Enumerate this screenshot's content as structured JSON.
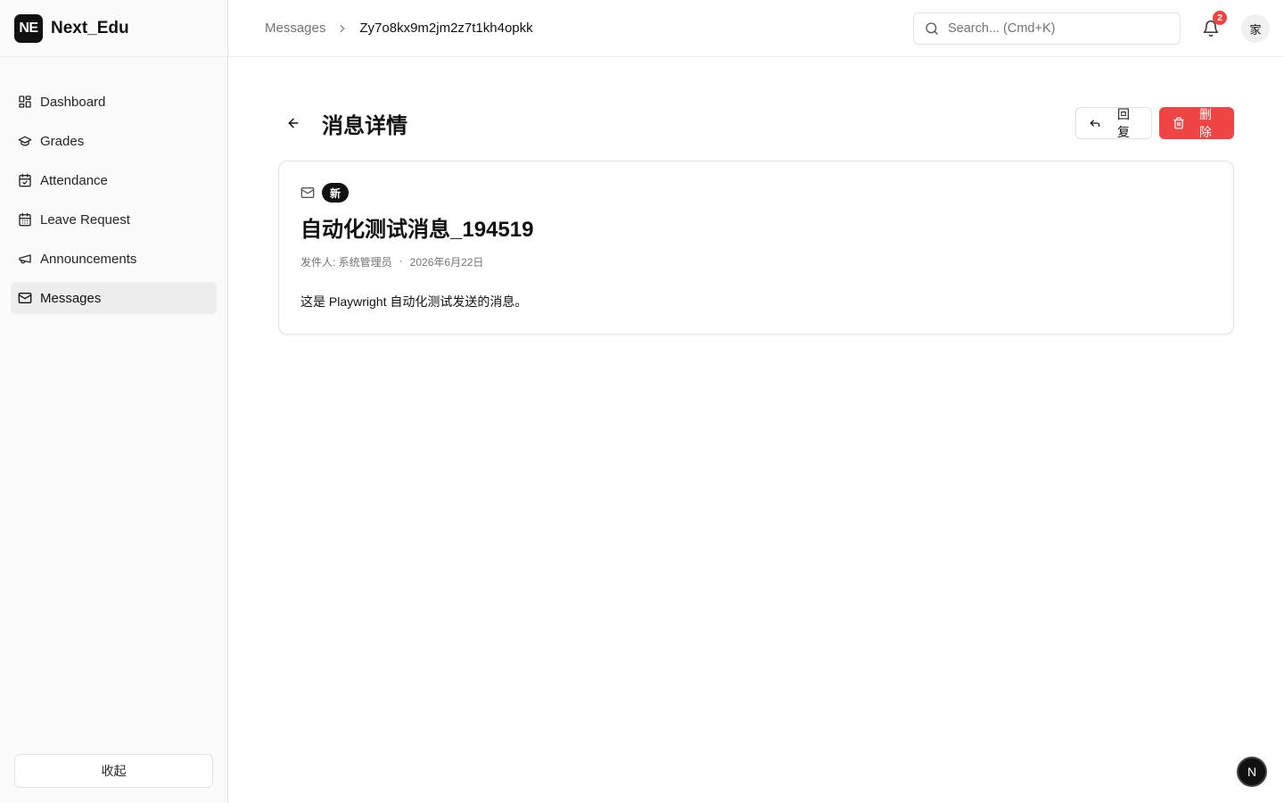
{
  "brand": {
    "logo_text": "NE",
    "name": "Next_Edu"
  },
  "sidebar": {
    "items": [
      {
        "label": "Dashboard",
        "icon": "dashboard-icon",
        "active": false
      },
      {
        "label": "Grades",
        "icon": "graduation-cap-icon",
        "active": false
      },
      {
        "label": "Attendance",
        "icon": "calendar-check-icon",
        "active": false
      },
      {
        "label": "Leave Request",
        "icon": "calendar-icon",
        "active": false
      },
      {
        "label": "Announcements",
        "icon": "megaphone-icon",
        "active": false
      },
      {
        "label": "Messages",
        "icon": "mail-icon",
        "active": true
      }
    ],
    "collapse_label": "收起"
  },
  "topbar": {
    "breadcrumb": {
      "parent": "Messages",
      "current": "Zy7o8kx9m2jm2z7t1kh4opkk"
    },
    "search": {
      "placeholder": "Search... (Cmd+K)",
      "value": ""
    },
    "notifications": {
      "count": "2"
    },
    "avatar_text": "家"
  },
  "page": {
    "title": "消息详情",
    "reply_label": "回复",
    "delete_label": "删除"
  },
  "message": {
    "badge": "新",
    "title": "自动化测试消息_194519",
    "sender": "发件人: 系统管理员",
    "separator": "·",
    "date": "2026年6月22日",
    "body": "这是 Playwright 自动化测试发送的消息。"
  },
  "dev_badge": "N",
  "colors": {
    "danger": "#ef4444",
    "primary": "#111111",
    "muted": "#737373",
    "active_bg": "#ededed"
  }
}
